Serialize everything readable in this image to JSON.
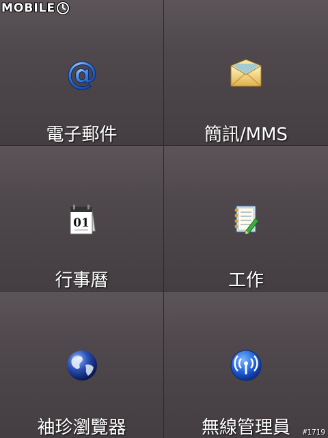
{
  "watermark": {
    "text": "MOBILE"
  },
  "tiles": [
    {
      "label": "電子郵件",
      "icon": "email-at-icon"
    },
    {
      "label": "簡訊/MMS",
      "icon": "envelope-icon"
    },
    {
      "label": "行事曆",
      "icon": "calendar-icon"
    },
    {
      "label": "工作",
      "icon": "task-notebook-icon"
    },
    {
      "label": "袖珍瀏覽器",
      "icon": "globe-icon"
    },
    {
      "label": "無線管理員",
      "icon": "wireless-icon"
    }
  ],
  "calendar_day": "01",
  "corner_tag": "#1719",
  "colors": {
    "background": "#4a4548",
    "text": "#ffffff",
    "divider": "#2c282a"
  }
}
